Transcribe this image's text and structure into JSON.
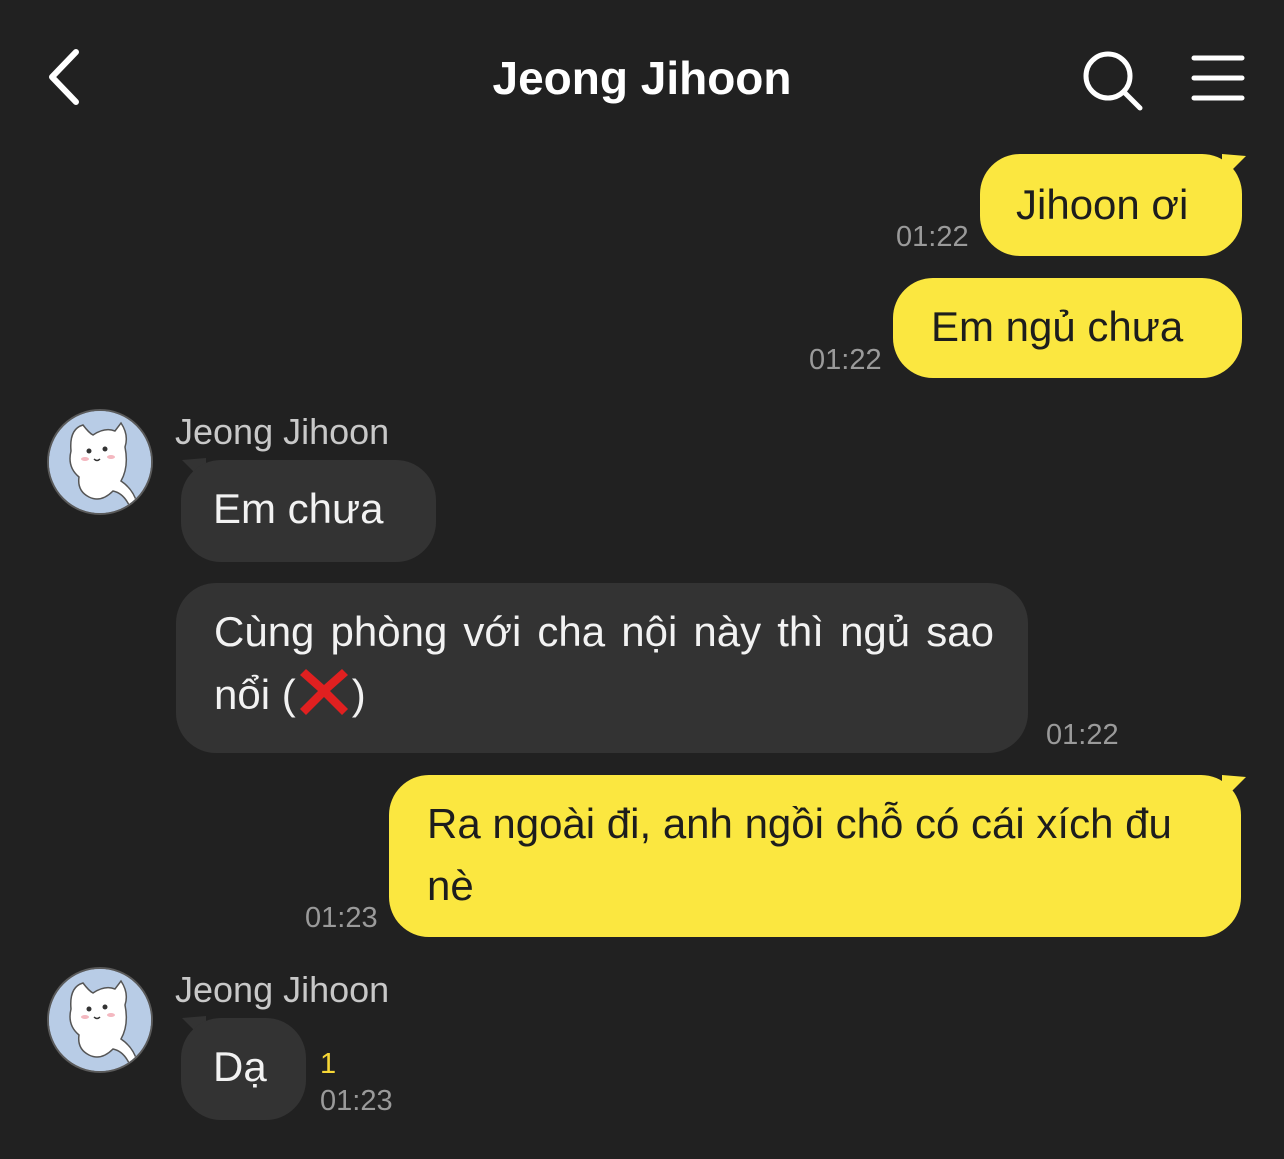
{
  "header": {
    "title": "Jeong Jihoon",
    "back_icon": "chevron-left-icon",
    "search_icon": "search-icon",
    "menu_icon": "hamburger-menu-icon"
  },
  "messages": [
    {
      "from": "me",
      "text": "Jihoon ơi",
      "time": "01:22"
    },
    {
      "from": "me",
      "text": "Em ngủ chưa",
      "time": "01:22"
    },
    {
      "from": "them",
      "sender": "Jeong Jihoon",
      "text": "Em chưa"
    },
    {
      "from": "them",
      "text_before": "Cùng phòng với cha nội này thì ngủ sao nổi (",
      "emoji": "cross-mark",
      "text_after": ")",
      "time": "01:22"
    },
    {
      "from": "me",
      "text": "Ra ngoài đi, anh ngồi chỗ có cái xích đu nè",
      "time": "01:23"
    },
    {
      "from": "them",
      "sender": "Jeong Jihoon",
      "text": "Dạ",
      "unread": "1",
      "time": "01:23"
    }
  ],
  "colors": {
    "background": "#212121",
    "my_bubble": "#fbe740",
    "their_bubble": "#333333",
    "unread": "#f7d736"
  }
}
